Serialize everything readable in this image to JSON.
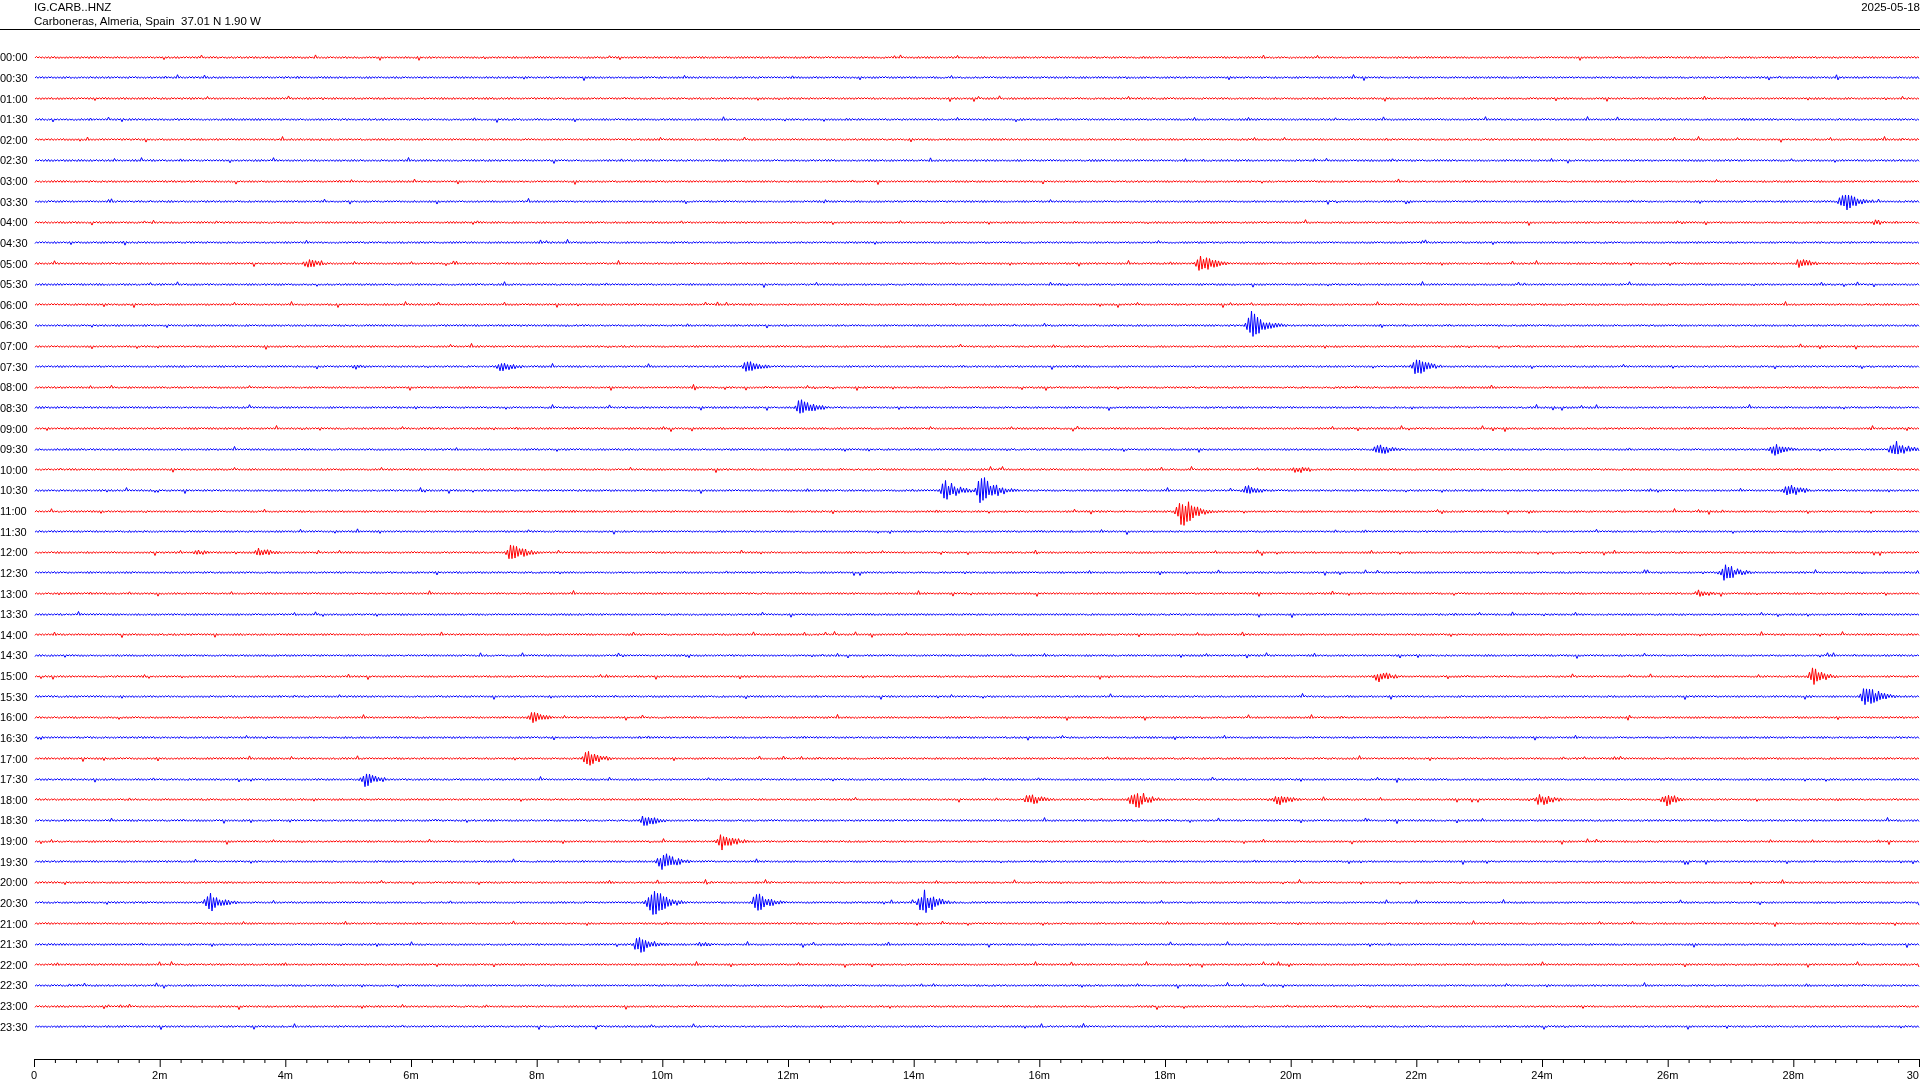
{
  "header": {
    "station": "IG.CARB..HNZ",
    "location": "Carboneras, Almeria, Spain  37.01 N 1.90 W",
    "date": "2025-05-18"
  },
  "rows": [
    {
      "time": "00:00",
      "color": "#ff0000"
    },
    {
      "time": "00:30",
      "color": "#0000ff"
    },
    {
      "time": "01:00",
      "color": "#ff0000"
    },
    {
      "time": "01:30",
      "color": "#0000ff"
    },
    {
      "time": "02:00",
      "color": "#ff0000"
    },
    {
      "time": "02:30",
      "color": "#0000ff"
    },
    {
      "time": "03:00",
      "color": "#ff0000"
    },
    {
      "time": "03:30",
      "color": "#0000ff"
    },
    {
      "time": "04:00",
      "color": "#ff0000"
    },
    {
      "time": "04:30",
      "color": "#0000ff"
    },
    {
      "time": "05:00",
      "color": "#ff0000"
    },
    {
      "time": "05:30",
      "color": "#0000ff"
    },
    {
      "time": "06:00",
      "color": "#ff0000"
    },
    {
      "time": "06:30",
      "color": "#0000ff"
    },
    {
      "time": "07:00",
      "color": "#ff0000"
    },
    {
      "time": "07:30",
      "color": "#0000ff"
    },
    {
      "time": "08:00",
      "color": "#ff0000"
    },
    {
      "time": "08:30",
      "color": "#0000ff"
    },
    {
      "time": "09:00",
      "color": "#ff0000"
    },
    {
      "time": "09:30",
      "color": "#0000ff"
    },
    {
      "time": "10:00",
      "color": "#ff0000"
    },
    {
      "time": "10:30",
      "color": "#0000ff"
    },
    {
      "time": "11:00",
      "color": "#ff0000"
    },
    {
      "time": "11:30",
      "color": "#0000ff"
    },
    {
      "time": "12:00",
      "color": "#ff0000"
    },
    {
      "time": "12:30",
      "color": "#0000ff"
    },
    {
      "time": "13:00",
      "color": "#ff0000"
    },
    {
      "time": "13:30",
      "color": "#0000ff"
    },
    {
      "time": "14:00",
      "color": "#ff0000"
    },
    {
      "time": "14:30",
      "color": "#0000ff"
    },
    {
      "time": "15:00",
      "color": "#ff0000"
    },
    {
      "time": "15:30",
      "color": "#0000ff"
    },
    {
      "time": "16:00",
      "color": "#ff0000"
    },
    {
      "time": "16:30",
      "color": "#0000ff"
    },
    {
      "time": "17:00",
      "color": "#ff0000"
    },
    {
      "time": "17:30",
      "color": "#0000ff"
    },
    {
      "time": "18:00",
      "color": "#ff0000"
    },
    {
      "time": "18:30",
      "color": "#0000ff"
    },
    {
      "time": "19:00",
      "color": "#ff0000"
    },
    {
      "time": "19:30",
      "color": "#0000ff"
    },
    {
      "time": "20:00",
      "color": "#ff0000"
    },
    {
      "time": "20:30",
      "color": "#0000ff"
    },
    {
      "time": "21:00",
      "color": "#ff0000"
    },
    {
      "time": "21:30",
      "color": "#0000ff"
    },
    {
      "time": "22:00",
      "color": "#ff0000"
    },
    {
      "time": "22:30",
      "color": "#0000ff"
    },
    {
      "time": "23:00",
      "color": "#ff0000"
    },
    {
      "time": "23:30",
      "color": "#0000ff"
    }
  ],
  "axis": {
    "ticks": [
      "0",
      "2m",
      "4m",
      "6m",
      "8m",
      "10m",
      "12m",
      "14m",
      "16m",
      "18m",
      "20m",
      "22m",
      "24m",
      "26m",
      "28m",
      "30"
    ]
  }
}
